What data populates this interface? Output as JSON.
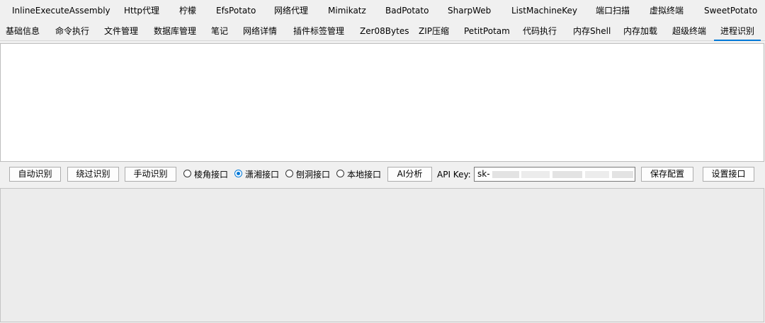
{
  "tabs_row1": [
    {
      "label": "InlineExecuteAssembly"
    },
    {
      "label": "Http代理"
    },
    {
      "label": "柠檬"
    },
    {
      "label": "EfsPotato"
    },
    {
      "label": "网络代理"
    },
    {
      "label": "Mimikatz"
    },
    {
      "label": "BadPotato"
    },
    {
      "label": "SharpWeb"
    },
    {
      "label": "ListMachineKey"
    },
    {
      "label": "端口扫描"
    },
    {
      "label": "虚拟终端"
    },
    {
      "label": "SweetPotato"
    }
  ],
  "tabs_row2": [
    {
      "label": "基础信息"
    },
    {
      "label": "命令执行"
    },
    {
      "label": "文件管理"
    },
    {
      "label": "数据库管理"
    },
    {
      "label": "笔记"
    },
    {
      "label": "网络详情"
    },
    {
      "label": "插件标签管理"
    },
    {
      "label": "Zer08Bytes"
    },
    {
      "label": "ZIP压缩"
    },
    {
      "label": "PetitPotam"
    },
    {
      "label": "代码执行"
    },
    {
      "label": "内存Shell"
    },
    {
      "label": "内存加载"
    },
    {
      "label": "超级终端"
    },
    {
      "label": "进程识别",
      "active": true
    }
  ],
  "toolbar": {
    "auto_detect": "自动识别",
    "bypass_detect": "绕过识别",
    "manual_detect": "手动识别",
    "radios": [
      {
        "label": "棱角接口",
        "checked": false
      },
      {
        "label": "潇湘接口",
        "checked": true
      },
      {
        "label": "刨洞接口",
        "checked": false
      },
      {
        "label": "本地接口",
        "checked": false
      }
    ],
    "ai_analyze": "AI分析",
    "api_key_label": "API Key:",
    "api_key_value": "sk-",
    "save_config": "保存配置",
    "set_interface": "设置接口"
  },
  "colors": {
    "accent": "#0078d7",
    "window_bg": "#f0f0f0"
  }
}
